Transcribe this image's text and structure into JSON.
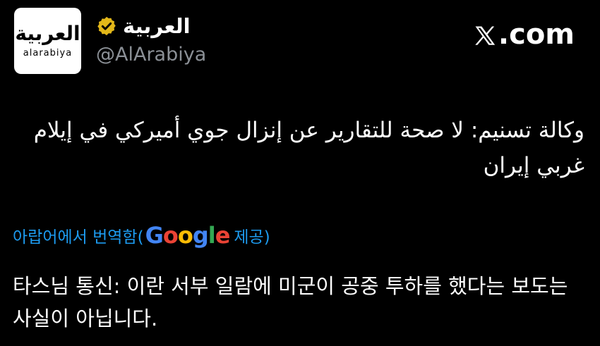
{
  "header": {
    "avatar": {
      "arabic_logo": "العربية",
      "latin_logo": "alarabiya"
    },
    "display_name": "العربية",
    "handle": "@AlArabiya",
    "verified_icon": "verified-badge-icon",
    "site_label": ".com",
    "site_icon": "x-logo-icon"
  },
  "tweet": {
    "arabic_text": "وكالة تسنيم: لا صحة للتقارير عن إنزال جوي أميركي في إيلام غربي إيران",
    "translation_label_pre": "아랍어에서 번역함(",
    "translation_provider": "Google",
    "translation_label_post": " 제공)",
    "translated_text": "타스님 통신: 이란 서부 일람에 미군이 공중 투하를 했다는 보도는 사실이 아닙니다."
  },
  "colors": {
    "background": "#000000",
    "link": "#1d9bf0",
    "badge": "#e2b719",
    "muted": "#8b9096"
  }
}
